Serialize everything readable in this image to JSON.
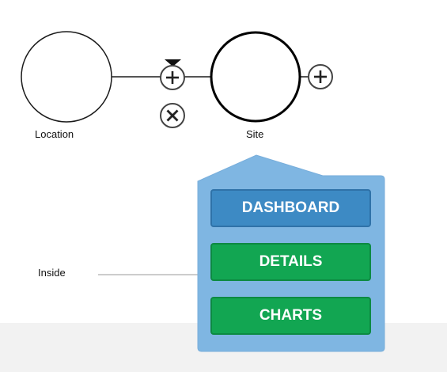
{
  "nodes": {
    "location": {
      "label": "Location"
    },
    "site": {
      "label": "Site"
    }
  },
  "connector": {
    "label": "Inside"
  },
  "context_menu": {
    "dashboard_label": "DASHBOARD",
    "details_label": "DETAILS",
    "charts_label": "CHARTS"
  },
  "icons": {
    "add_between": "plus-circle-icon",
    "remove": "close-circle-icon",
    "add_after": "plus-circle-icon",
    "marker": "triangle-down-icon"
  },
  "colors": {
    "menu_background": "#7fb6e2",
    "dashboard_button": "#3d8ac4",
    "action_button": "#12a652",
    "footer": "#f2f2f2"
  }
}
